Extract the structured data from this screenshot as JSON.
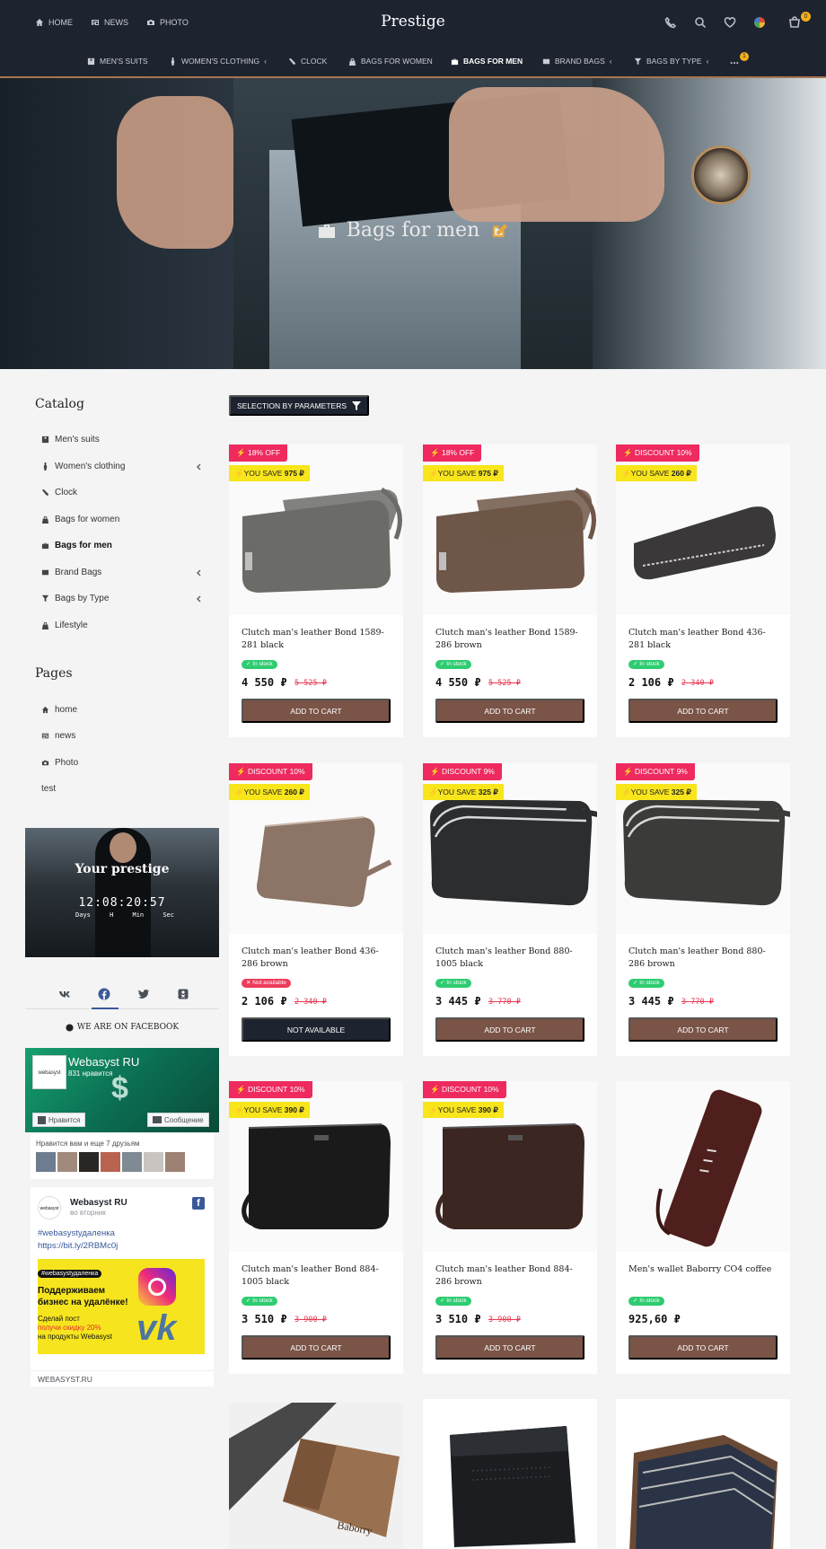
{
  "colors": {
    "header_bg": "#1e2330",
    "accent": "#7a5447",
    "discount": "#ee2a5e",
    "save_badge": "#f8e51b",
    "in_stock": "#2ecc71",
    "out_of_stock": "#ef3b5b",
    "nav_underline": "#a8754f"
  },
  "header": {
    "top_links": [
      {
        "label": "HOME",
        "icon": "home-icon"
      },
      {
        "label": "NEWS",
        "icon": "news-icon"
      },
      {
        "label": "PHOTO",
        "icon": "camera-icon"
      }
    ],
    "logo": "Prestige",
    "icons": [
      "phone-icon",
      "search-icon",
      "heart-icon",
      "user-avatar-icon",
      "cart-icon"
    ],
    "cart_count": "0",
    "nav": [
      {
        "label": "MEN'S SUITS",
        "icon": "suit-icon",
        "has_submenu": false
      },
      {
        "label": "WOMEN'S CLOTHING",
        "icon": "dress-icon",
        "has_submenu": true
      },
      {
        "label": "CLOCK",
        "icon": "clock-icon",
        "has_submenu": false
      },
      {
        "label": "BAGS FOR WOMEN",
        "icon": "bag-icon",
        "has_submenu": false
      },
      {
        "label": "BAGS FOR MEN",
        "icon": "briefcase-icon",
        "has_submenu": false,
        "active": true
      },
      {
        "label": "BRAND BAGS",
        "icon": "wallet-icon",
        "has_submenu": true
      },
      {
        "label": "BAGS BY TYPE",
        "icon": "filter-icon",
        "has_submenu": true
      }
    ],
    "more_label": "...",
    "more_count": "1"
  },
  "hero": {
    "title": "Bags for men",
    "icon": "briefcase-icon"
  },
  "sidebar": {
    "catalog_title": "Catalog",
    "catalog": [
      {
        "label": "Men's suits",
        "icon": "suit-icon",
        "chevron": false
      },
      {
        "label": "Women's clothing",
        "icon": "dress-icon",
        "chevron": true
      },
      {
        "label": "Clock",
        "icon": "clock-icon",
        "chevron": false
      },
      {
        "label": "Bags for women",
        "icon": "bag-icon",
        "chevron": false
      },
      {
        "label": "Bags for men",
        "icon": "briefcase-icon",
        "chevron": false,
        "active": true
      },
      {
        "label": "Brand Bags",
        "icon": "wallet-icon",
        "chevron": true
      },
      {
        "label": "Bags by Type",
        "icon": "filter-icon",
        "chevron": true
      },
      {
        "label": "Lifestyle",
        "icon": "bag-icon",
        "chevron": false
      }
    ],
    "pages_title": "Pages",
    "pages": [
      {
        "label": "home",
        "icon": "home-icon"
      },
      {
        "label": "news",
        "icon": "news-icon"
      },
      {
        "label": "Photo",
        "icon": "camera-icon"
      },
      {
        "label": "test",
        "icon": ""
      }
    ],
    "promo": {
      "title": "Your prestige",
      "timer": "12:08:20:57",
      "labels": [
        "Days",
        "H",
        "Min",
        "Sec"
      ]
    },
    "social_tabs": [
      "vk-icon",
      "facebook-icon",
      "twitter-icon",
      "odnoklassniki-icon"
    ],
    "facebook_heading": "WE ARE ON FACEBOOK",
    "fb": {
      "page_name": "Webasyst RU",
      "likes": "831 нравится",
      "logo_text": "webasyst",
      "like_button": "Нравится",
      "message_button": "Сообщение",
      "friends_text": "Нравится вам и еще 7 друзьям",
      "post_author": "Webasyst RU",
      "post_day": "во вторник",
      "post_tag": "#webasystудаленка",
      "post_link": "https://bit.ly/2RBMc0j",
      "banner_tag": "#webasystудаленка",
      "banner_line1": "Поддерживаем",
      "banner_line2": "бизнес на удалёнке!",
      "banner_line3": "Сделай пост",
      "banner_line4": "получи скидку 20%",
      "banner_line5": "на продукты Webasyst",
      "banner_vk": "vk",
      "footer": "WEBASYST.RU"
    }
  },
  "filter_button": "SELECTION BY PARAMETERS",
  "products": [
    {
      "badge": "18% OFF",
      "save_prefix": "YOU SAVE",
      "save": "975",
      "title": "Clutch man's leather Bond 1589-281 black",
      "stock": "In stock",
      "in_stock": true,
      "price": "4 550 ₽",
      "old_price": "5 525 ₽",
      "button": "ADD TO CART",
      "color": "#6b6b68"
    },
    {
      "badge": "18% OFF",
      "save_prefix": "YOU SAVE",
      "save": "975",
      "title": "Clutch man's leather Bond 1589-286 brown",
      "stock": "In stock",
      "in_stock": true,
      "price": "4 550 ₽",
      "old_price": "5 525 ₽",
      "button": "ADD TO CART",
      "color": "#6e5648"
    },
    {
      "badge": "DISCOUNT  10%",
      "save_prefix": "YOU SAVE",
      "save": "260",
      "title": "Clutch man's leather Bond 436-281 black",
      "stock": "In stock",
      "in_stock": true,
      "price": "2 106 ₽",
      "old_price": "2 340 ₽",
      "button": "ADD TO CART",
      "color": "#3a3838"
    },
    {
      "badge": "DISCOUNT  10%",
      "save_prefix": "YOU SAVE",
      "save": "260",
      "title": "Clutch man's leather Bond 436-286 brown",
      "stock": "Not available",
      "in_stock": false,
      "price": "2 106 ₽",
      "old_price": "2 340 ₽",
      "button": "NOT AVAILABLE",
      "color": "#8c7466"
    },
    {
      "badge": "DISCOUNT  9%",
      "save_prefix": "YOU SAVE",
      "save": "325",
      "title": "Clutch man's leather Bond 880-1005 black",
      "stock": "In stock",
      "in_stock": true,
      "price": "3 445 ₽",
      "old_price": "3 770 ₽",
      "button": "ADD TO CART",
      "color": "#2b2d2f"
    },
    {
      "badge": "DISCOUNT  9%",
      "save_prefix": "YOU SAVE",
      "save": "325",
      "title": "Clutch man's leather Bond 880-286 brown",
      "stock": "In stock",
      "in_stock": true,
      "price": "3 445 ₽",
      "old_price": "3 770 ₽",
      "button": "ADD TO CART",
      "color": "#3b3b3a"
    },
    {
      "badge": "DISCOUNT  10%",
      "save_prefix": "YOU SAVE",
      "save": "390",
      "title": "Clutch man's leather Bond 884-1005 black",
      "stock": "In stock",
      "in_stock": true,
      "price": "3 510 ₽",
      "old_price": "3 900 ₽",
      "button": "ADD TO CART",
      "color": "#1a1a1b"
    },
    {
      "badge": "DISCOUNT  10%",
      "save_prefix": "YOU SAVE",
      "save": "390",
      "title": "Clutch man's leather Bond 884-286 brown",
      "stock": "In stock",
      "in_stock": true,
      "price": "3 510 ₽",
      "old_price": "3 900 ₽",
      "button": "ADD TO CART",
      "color": "#3b2622"
    },
    {
      "badge": "",
      "save_prefix": "",
      "save": "",
      "title": "Men's wallet Baborry CO4 coffee",
      "stock": "In stock",
      "in_stock": true,
      "price": "925,60 ₽",
      "old_price": "",
      "button": "ADD TO CART",
      "color": "#4e1f1c"
    }
  ],
  "bottom_products": [
    {
      "color": "#9a7150",
      "label": "Baborry"
    },
    {
      "color": "#1b1d20",
      "label": ""
    },
    {
      "color": "#2a3446",
      "label": ""
    }
  ]
}
